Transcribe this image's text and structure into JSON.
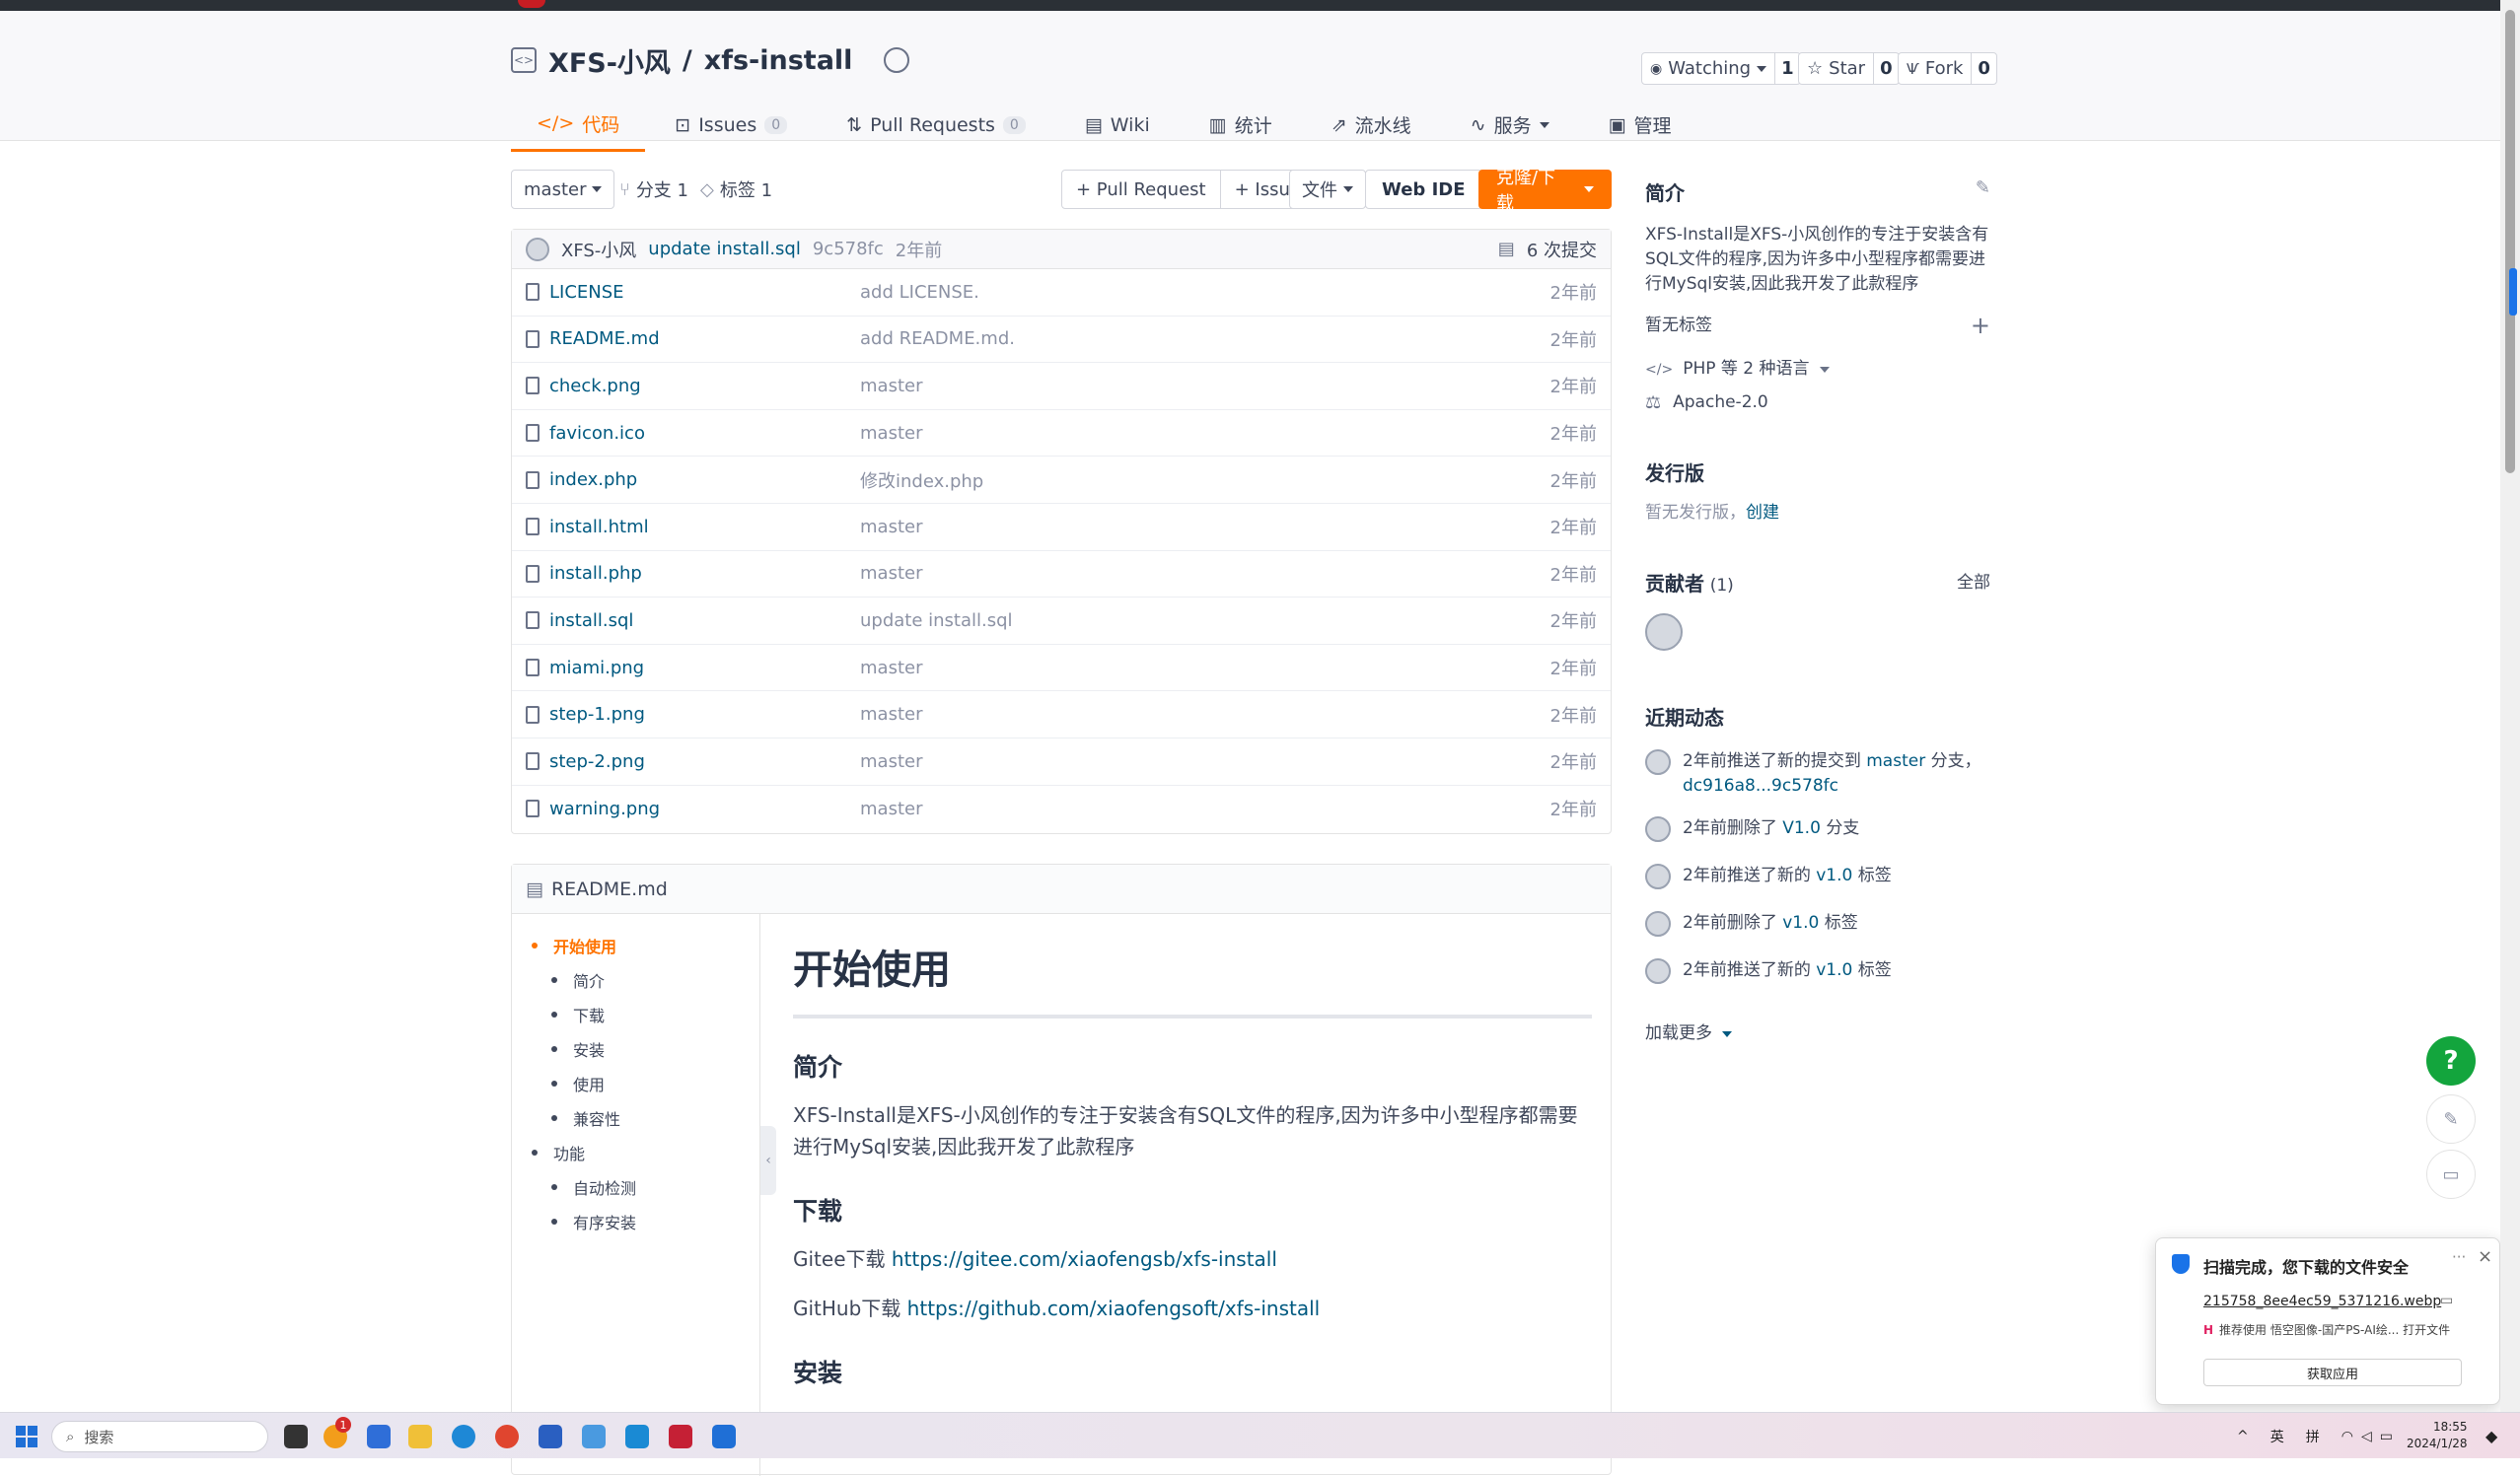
{
  "repo": {
    "owner": "XFS-小风",
    "separator": "/",
    "name": "xfs-install",
    "watching_label": "Watching",
    "watching_count": "1",
    "star_label": "Star",
    "star_count": "0",
    "fork_label": "Fork",
    "fork_count": "0"
  },
  "tabs": [
    {
      "label": "代码",
      "icon": "code-icon"
    },
    {
      "label": "Issues",
      "count": "0",
      "icon": "issue-icon"
    },
    {
      "label": "Pull Requests",
      "count": "0",
      "icon": "pull-request-icon"
    },
    {
      "label": "Wiki",
      "icon": "book-icon"
    },
    {
      "label": "统计",
      "icon": "bar-chart-icon"
    },
    {
      "label": "流水线",
      "icon": "rocket-icon"
    },
    {
      "label": "服务",
      "icon": "pulse-icon"
    },
    {
      "label": "管理",
      "icon": "settings-icon"
    }
  ],
  "toolbar": {
    "branch": "master",
    "branches": "分支 1",
    "tags": "标签 1",
    "new_pr": "+ Pull Request",
    "new_issue": "+ Issue",
    "file_menu": "文件",
    "web_ide": "Web IDE",
    "clone": "克隆/下载"
  },
  "last_commit": {
    "author": "XFS-小风",
    "message": "update install.sql",
    "hash": "9c578fc",
    "time": "2年前",
    "commits": "6 次提交"
  },
  "files": [
    {
      "name": "LICENSE",
      "message": "add LICENSE.",
      "time": "2年前"
    },
    {
      "name": "README.md",
      "message": "add README.md.",
      "time": "2年前"
    },
    {
      "name": "check.png",
      "message": "master",
      "time": "2年前"
    },
    {
      "name": "favicon.ico",
      "message": "master",
      "time": "2年前"
    },
    {
      "name": "index.php",
      "message": "修改index.php",
      "time": "2年前"
    },
    {
      "name": "install.html",
      "message": "master",
      "time": "2年前"
    },
    {
      "name": "install.php",
      "message": "master",
      "time": "2年前"
    },
    {
      "name": "install.sql",
      "message": "update install.sql",
      "time": "2年前"
    },
    {
      "name": "miami.png",
      "message": "master",
      "time": "2年前"
    },
    {
      "name": "step-1.png",
      "message": "master",
      "time": "2年前"
    },
    {
      "name": "step-2.png",
      "message": "master",
      "time": "2年前"
    },
    {
      "name": "warning.png",
      "message": "master",
      "time": "2年前"
    }
  ],
  "readme": {
    "filename": "README.md",
    "toc": [
      {
        "label": "开始使用",
        "level": 1,
        "active": true
      },
      {
        "label": "简介",
        "level": 2
      },
      {
        "label": "下载",
        "level": 2
      },
      {
        "label": "安装",
        "level": 2
      },
      {
        "label": "使用",
        "level": 2
      },
      {
        "label": "兼容性",
        "level": 2
      },
      {
        "label": "功能",
        "level": 1
      },
      {
        "label": "自动检测",
        "level": 2
      },
      {
        "label": "有序安装",
        "level": 2
      }
    ],
    "h1": "开始使用",
    "intro_heading": "简介",
    "intro_text": "XFS-Install是XFS-小风创作的专注于安装含有SQL文件的程序,因为许多中小型程序都需要进行MySql安装,因此我开发了此款程序",
    "download_heading": "下载",
    "gitee_label": "Gitee下载",
    "gitee_url": "https://gitee.com/xiaofengsb/xfs-install",
    "github_label": "GitHub下载",
    "github_url": "https://github.com/xiaofengsoft/xfs-install",
    "install_heading": "安装"
  },
  "sidebar": {
    "intro_title": "简介",
    "intro_text": "XFS-Install是XFS-小风创作的专注于安装含有SQL文件的程序,因为许多中小型程序都需要进行MySql安装,因此我开发了此款程序",
    "no_tags": "暂无标签",
    "languages": "PHP 等 2 种语言",
    "license": "Apache-2.0",
    "release_title": "发行版",
    "no_release": "暂无发行版，",
    "create_link": "创建",
    "contributors_title": "贡献者",
    "contributors_count": "(1)",
    "contributors_all": "全部",
    "activity_title": "近期动态",
    "activities": [
      {
        "text": "2年前推送了新的提交到",
        "link": "master",
        "suffix": "分支，",
        "line2": "dc916a8...9c578fc"
      },
      {
        "text": "2年前删除了",
        "link": "V1.0",
        "suffix": "分支"
      },
      {
        "text": "2年前推送了新的",
        "link": "v1.0",
        "suffix": "标签"
      },
      {
        "text": "2年前删除了",
        "link": "v1.0",
        "suffix": "标签"
      },
      {
        "text": "2年前推送了新的",
        "link": "v1.0",
        "suffix": "标签"
      }
    ],
    "load_more": "加载更多"
  },
  "float_buttons": {
    "help": "?"
  },
  "popup": {
    "title": "扫描完成，您下载的文件安全",
    "file": "215758_8ee4ec59_5371216.webp",
    "promo": "推荐使用 悟空图像-国产PS-AI绘... 打开文件",
    "action": "获取应用",
    "more": "···",
    "close": "×"
  },
  "taskbar": {
    "search": "搜索",
    "badge": "1",
    "ime1": "英",
    "ime2": "拼",
    "time": "18:55",
    "date": "2024/1/28"
  },
  "colors": {
    "accent": "#fe7300",
    "link": "#005980",
    "help_button": "#13a53d"
  }
}
